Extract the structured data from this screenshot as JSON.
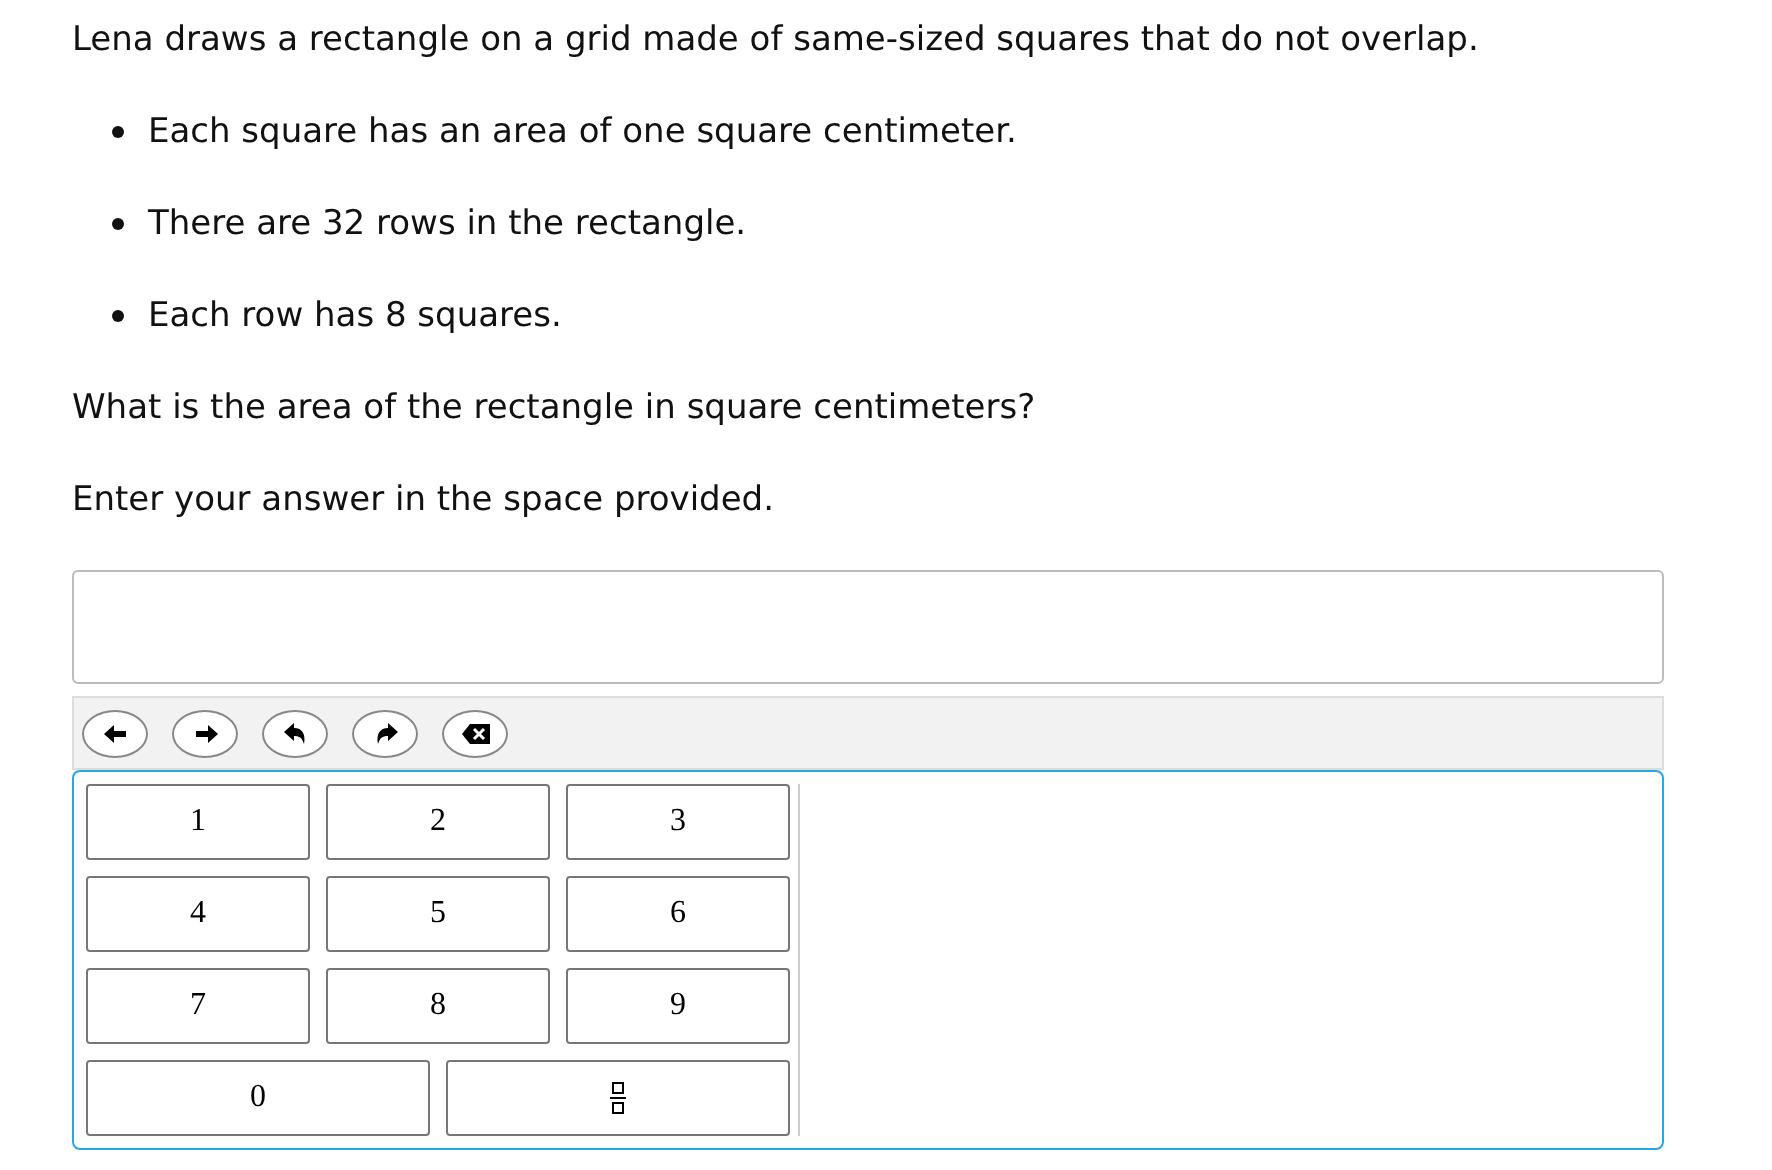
{
  "prompt": "Lena draws a rectangle on a grid made of same-sized squares that do not overlap.",
  "bullets": [
    "Each square has an area of one square centimeter.",
    "There are 32 rows in the rectangle.",
    "Each row has 8 squares."
  ],
  "question": "What is the area of the rectangle in square centimeters?",
  "instruction": "Enter your answer in the space provided.",
  "toolbar": [
    {
      "kind": "left"
    },
    {
      "kind": "right"
    },
    {
      "kind": "undo"
    },
    {
      "kind": "redo"
    },
    {
      "kind": "delete"
    }
  ],
  "keys": [
    {
      "kind": "digit",
      "label": "1"
    },
    {
      "kind": "digit",
      "label": "2"
    },
    {
      "kind": "digit",
      "label": "3"
    },
    {
      "kind": "digit",
      "label": "4"
    },
    {
      "kind": "digit",
      "label": "5"
    },
    {
      "kind": "digit",
      "label": "6"
    },
    {
      "kind": "digit",
      "label": "7"
    },
    {
      "kind": "digit",
      "label": "8"
    },
    {
      "kind": "digit",
      "label": "9"
    },
    {
      "kind": "digit",
      "label": "0"
    },
    {
      "kind": "fraction"
    }
  ]
}
